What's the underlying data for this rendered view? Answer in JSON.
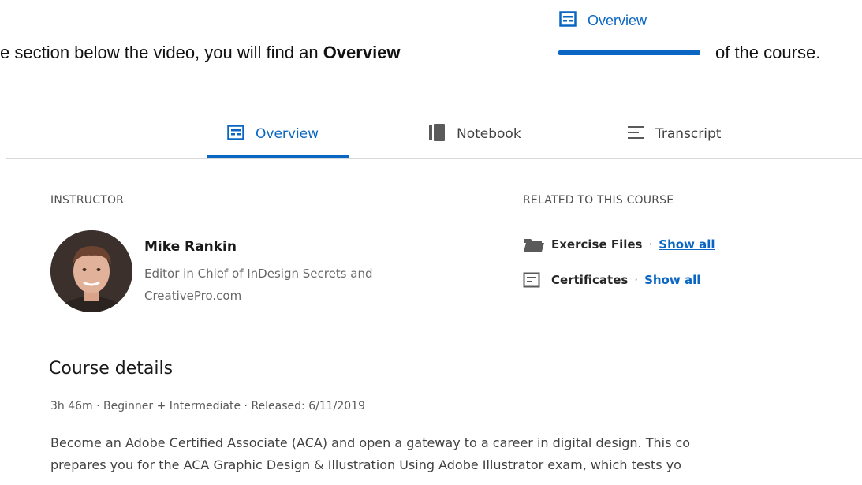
{
  "instruction": {
    "text_before": "e section below the video, you will find an ",
    "emphasis": "Overview",
    "text_after": "of the course.",
    "callout_label": "Overview"
  },
  "tabs": [
    {
      "label": "Overview",
      "icon": "overview-icon",
      "active": true
    },
    {
      "label": "Notebook",
      "icon": "notebook-icon",
      "active": false
    },
    {
      "label": "Transcript",
      "icon": "transcript-icon",
      "active": false
    }
  ],
  "instructor": {
    "heading": "INSTRUCTOR",
    "name": "Mike Rankin",
    "title": "Editor in Chief of InDesign Secrets and CreativePro.com"
  },
  "related": {
    "heading": "RELATED TO THIS COURSE",
    "items": [
      {
        "label": "Exercise Files",
        "separator": "·",
        "link": "Show all",
        "icon": "folder-icon"
      },
      {
        "label": "Certificates",
        "separator": "·",
        "link": "Show all",
        "icon": "certificate-icon"
      }
    ]
  },
  "course": {
    "title": "Course details",
    "meta": "3h 46m · Beginner + Intermediate · Released: 6/11/2019",
    "description_lines": [
      "Become an Adobe Certified Associate (ACA) and open a gateway to a career in digital design. This co",
      "prepares you for the ACA Graphic Design & Illustration Using Adobe Illustrator exam, which tests yo"
    ]
  },
  "colors": {
    "accent": "#0a66c2",
    "divider": "#d9d9d9"
  }
}
